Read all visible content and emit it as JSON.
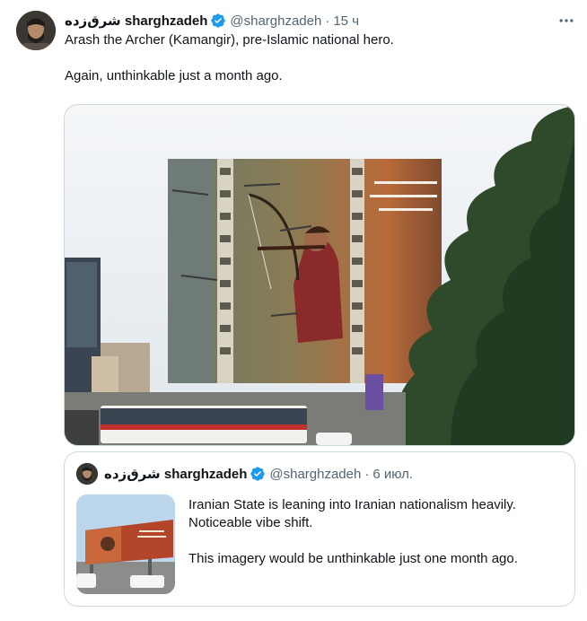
{
  "tweet": {
    "author_name": "شرق‌زده sharghzadeh",
    "handle": "@sharghzadeh",
    "separator": "·",
    "time": "15 ч",
    "text_line1": "Arash the Archer (Kamangir), pre-Islamic national hero.",
    "text_line2": "Again, unthinkable just a month ago.",
    "icons": {
      "verified": "verified-badge-icon",
      "more": "more-options-icon"
    }
  },
  "quoted_tweet": {
    "author_name": "شرق‌زده sharghzadeh",
    "handle": "@sharghzadeh",
    "separator": "·",
    "time": "6 июл.",
    "text_line1": "Iranian State is leaning into Iranian nationalism heavily. Noticeable vibe shift.",
    "text_line2": "This imagery would be unthinkable just one month ago."
  },
  "colors": {
    "text_primary": "#0f1419",
    "text_secondary": "#536471",
    "border": "#cfd9de",
    "verified_blue": "#1d9bf0"
  }
}
